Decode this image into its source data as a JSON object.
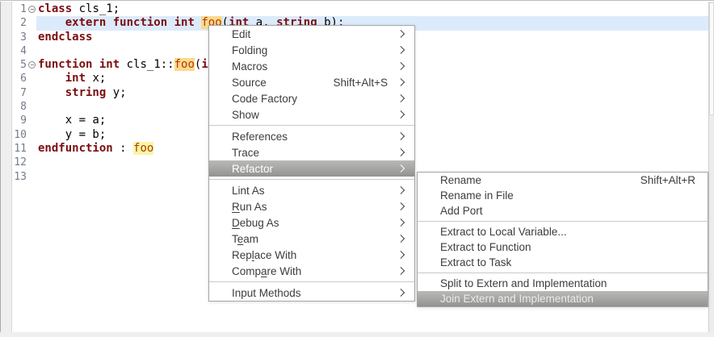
{
  "editor": {
    "lines": [
      {
        "num": "1",
        "fold": true,
        "segments": [
          [
            "kw",
            "class"
          ],
          [
            "pl",
            " cls_1;"
          ]
        ]
      },
      {
        "num": "2",
        "current": true,
        "segments": [
          [
            "pl",
            "    "
          ],
          [
            "kw",
            "extern"
          ],
          [
            "pl",
            " "
          ],
          [
            "kw",
            "function"
          ],
          [
            "pl",
            " "
          ],
          [
            "kw",
            "int"
          ],
          [
            "pl",
            " "
          ],
          [
            "occ",
            "foo"
          ],
          [
            "pl",
            "("
          ],
          [
            "kw",
            "int"
          ],
          [
            "pl",
            " a, "
          ],
          [
            "kw",
            "string"
          ],
          [
            "pl",
            " b);"
          ]
        ]
      },
      {
        "num": "3",
        "segments": [
          [
            "kw",
            "endclass"
          ]
        ]
      },
      {
        "num": "4",
        "segments": []
      },
      {
        "num": "5",
        "fold": true,
        "segments": [
          [
            "kw",
            "function"
          ],
          [
            "pl",
            " "
          ],
          [
            "kw",
            "int"
          ],
          [
            "pl",
            " cls_1::"
          ],
          [
            "occ",
            "foo"
          ],
          [
            "pl",
            "("
          ],
          [
            "kw",
            "int"
          ]
        ]
      },
      {
        "num": "6",
        "segments": [
          [
            "pl",
            "    "
          ],
          [
            "kw",
            "int"
          ],
          [
            "pl",
            " x;"
          ]
        ]
      },
      {
        "num": "7",
        "segments": [
          [
            "pl",
            "    "
          ],
          [
            "kw",
            "string"
          ],
          [
            "pl",
            " y;"
          ]
        ]
      },
      {
        "num": "8",
        "segments": []
      },
      {
        "num": "9",
        "segments": [
          [
            "pl",
            "    x = a;"
          ]
        ]
      },
      {
        "num": "10",
        "segments": [
          [
            "pl",
            "    y = b;"
          ]
        ]
      },
      {
        "num": "11",
        "segments": [
          [
            "kw",
            "endfunction"
          ],
          [
            "pl",
            " : "
          ],
          [
            "occy",
            "foo"
          ]
        ]
      },
      {
        "num": "12",
        "segments": []
      },
      {
        "num": "13",
        "segments": []
      }
    ]
  },
  "context_menu": {
    "items": [
      {
        "label": "Edit",
        "submenu": true
      },
      {
        "label": "Folding",
        "submenu": true
      },
      {
        "label": "Macros",
        "submenu": true
      },
      {
        "label": "Source",
        "shortcut": "Shift+Alt+S",
        "submenu": true
      },
      {
        "label": "Code Factory",
        "submenu": true
      },
      {
        "label": "Show",
        "submenu": true
      },
      {
        "sep": true
      },
      {
        "label": "References",
        "submenu": true
      },
      {
        "label": "Trace",
        "submenu": true
      },
      {
        "label": "Refactor",
        "submenu": true,
        "highlighted": true
      },
      {
        "sep": true
      },
      {
        "label": "Lint As",
        "submenu": true
      },
      {
        "label": "Run As",
        "submenu": true,
        "u": 0
      },
      {
        "label": "Debug As",
        "submenu": true,
        "u": 0
      },
      {
        "label": "Team",
        "submenu": true,
        "u": 1
      },
      {
        "label": "Replace With",
        "submenu": true,
        "u": 3
      },
      {
        "label": "Compare With",
        "submenu": true,
        "u": 4
      },
      {
        "sep": true
      },
      {
        "label": "Input Methods",
        "submenu": true
      }
    ]
  },
  "submenu": {
    "items": [
      {
        "label": "Rename",
        "shortcut": "Shift+Alt+R"
      },
      {
        "label": "Rename in File"
      },
      {
        "label": "Add Port"
      },
      {
        "sep": true
      },
      {
        "label": "Extract to Local Variable..."
      },
      {
        "label": "Extract to Function"
      },
      {
        "label": "Extract to Task"
      },
      {
        "sep": true
      },
      {
        "label": "Split to Extern and Implementation"
      },
      {
        "label": "Join Extern and Implementation",
        "highlighted": true
      }
    ]
  },
  "colors": {
    "keyword": "#7b0d10",
    "occurrence_text": "#b33c00",
    "occurrence_bg": "#fbd98e",
    "occurrence_bg_yellow": "#f8f6a6",
    "current_line_bg": "#dcebfb",
    "menu_highlight": "#a6a6a4"
  }
}
